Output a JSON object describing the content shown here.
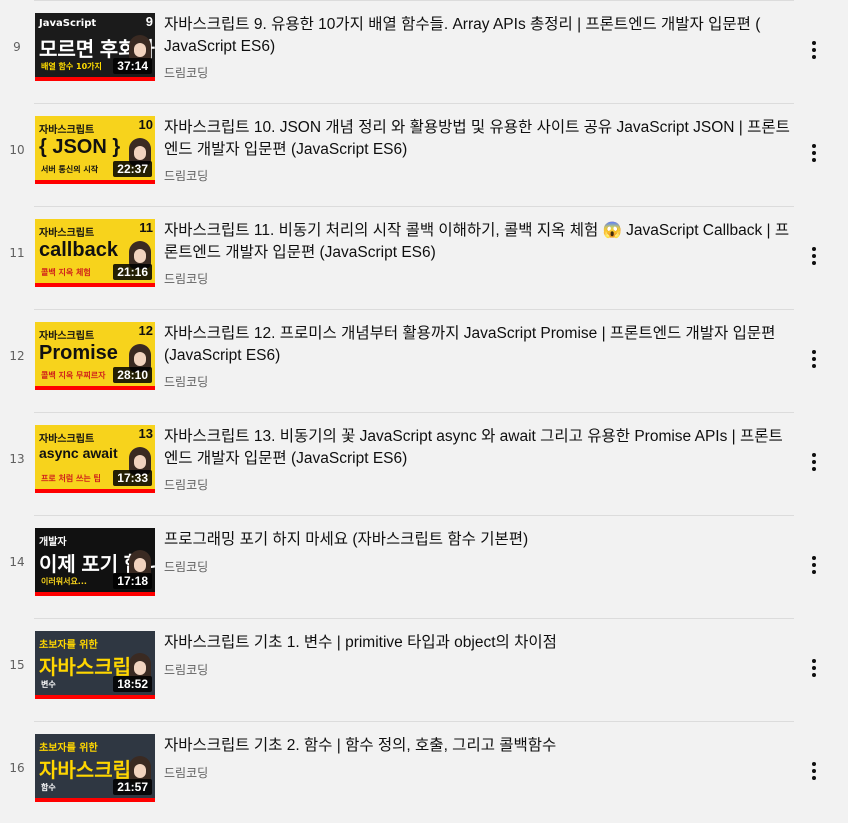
{
  "playlist": {
    "items": [
      {
        "index": "9",
        "title": "자바스크립트 9. 유용한 10가지 배열 함수들. Array APIs 총정리 | 프론트엔드 개발자 입문편 ( JavaScript ES6)",
        "channel": "드림코딩",
        "duration": "37:14",
        "thumb": {
          "bg": "#1b1b1b",
          "num": "9",
          "line1": "JavaScript",
          "line2": "모르면 후회하는",
          "line3": "배열 함수 10가지",
          "fg": "#ffffff",
          "accent": "#ffdd00"
        }
      },
      {
        "index": "10",
        "title": "자바스크립트 10. JSON 개념 정리 와 활용방법 및 유용한 사이트 공유 JavaScript JSON | 프론트엔드 개발자 입문편 (JavaScript ES6)",
        "channel": "드림코딩",
        "duration": "22:37",
        "thumb": {
          "bg": "#f7d31c",
          "num": "10",
          "line1": "자바스크립트",
          "line2": "{ JSON }",
          "line3": "서버 통신의 시작",
          "fg": "#111111",
          "accent": "#111111"
        }
      },
      {
        "index": "11",
        "title": "자바스크립트 11. 비동기 처리의 시작 콜백 이해하기, 콜백 지옥 체험 😱 JavaScript Callback | 프론트엔드 개발자 입문편 (JavaScript ES6)",
        "channel": "드림코딩",
        "duration": "21:16",
        "thumb": {
          "bg": "#f7d31c",
          "num": "11",
          "line1": "자바스크립트",
          "line2": "callback",
          "line3": "콜백 지옥 체험",
          "fg": "#111111",
          "accent": "#d0241b"
        }
      },
      {
        "index": "12",
        "title": "자바스크립트 12. 프로미스 개념부터 활용까지 JavaScript Promise | 프론트엔드 개발자 입문편 (JavaScript ES6)",
        "channel": "드림코딩",
        "duration": "28:10",
        "thumb": {
          "bg": "#f7d31c",
          "num": "12",
          "line1": "자바스크립트",
          "line2": "Promise",
          "line3": "콜백 지옥 무찌르자",
          "fg": "#111111",
          "accent": "#d0241b"
        }
      },
      {
        "index": "13",
        "title": "자바스크립트 13. 비동기의 꽃 JavaScript async 와 await 그리고 유용한 Promise APIs | 프론트엔드 개발자 입문편 (JavaScript ES6)",
        "channel": "드림코딩",
        "duration": "17:33",
        "thumb": {
          "bg": "#f7d31c",
          "num": "13",
          "line1": "자바스크립트",
          "line2": "async await",
          "line3": "프로 처럼 쓰는 팁",
          "fg": "#111111",
          "accent": "#d0241b"
        }
      },
      {
        "index": "14",
        "title": "프로그래밍 포기 하지 마세요 (자바스크립트 함수 기본편)",
        "channel": "드림코딩",
        "duration": "17:18",
        "thumb": {
          "bg": "#111111",
          "num": "",
          "line1": "개발자",
          "line2": "이제 포기 합니다",
          "line3": "이러워서요...",
          "fg": "#ffffff",
          "accent": "#f7d31c"
        }
      },
      {
        "index": "15",
        "title": "자바스크립트 기초 1. 변수 | primitive 타입과 object의 차이점",
        "channel": "드림코딩",
        "duration": "18:52",
        "thumb": {
          "bg": "#2f3742",
          "num": "",
          "line1": "초보자를 위한",
          "line2": "자바스크립트 기본",
          "line3": "변수",
          "fg": "#ffd600",
          "accent": "#ffffff"
        }
      },
      {
        "index": "16",
        "title": "자바스크립트 기초 2. 함수 | 함수 정의, 호출, 그리고 콜백함수",
        "channel": "드림코딩",
        "duration": "21:57",
        "thumb": {
          "bg": "#2f3742",
          "num": "",
          "line1": "초보자를 위한",
          "line2": "자바스크립트 기본",
          "line3": "함수",
          "fg": "#ffd600",
          "accent": "#ffffff"
        }
      }
    ]
  }
}
